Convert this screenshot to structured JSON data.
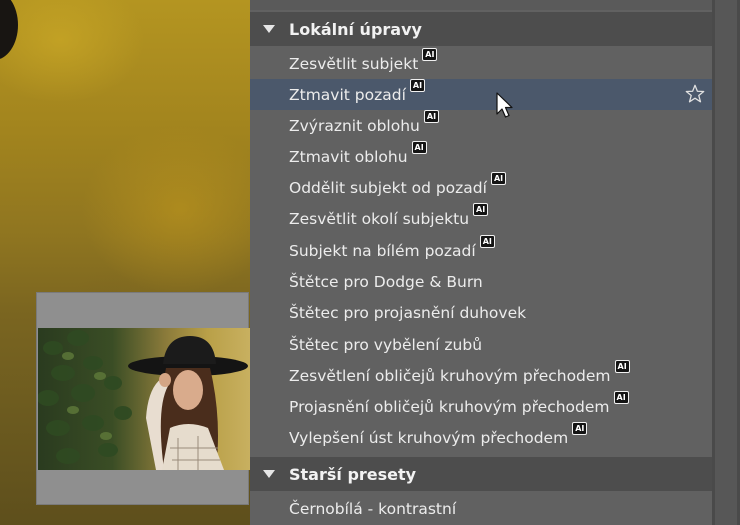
{
  "colors": {
    "panel_bg": "#616161",
    "header_bg": "#4d4d4d",
    "selected_bg": "#4b586b",
    "text": "#ececec"
  },
  "sections": [
    {
      "title": "Lokální úpravy",
      "expanded": true,
      "items": [
        {
          "label": "Zesvětlit subjekt",
          "ai": true,
          "badge": "AI"
        },
        {
          "label": "Ztmavit pozadí",
          "ai": true,
          "badge": "AI",
          "selected": true,
          "star_icon": "star-outline-icon"
        },
        {
          "label": "Zvýraznit oblohu",
          "ai": true,
          "badge": "AI"
        },
        {
          "label": "Ztmavit oblohu",
          "ai": true,
          "badge": "AI"
        },
        {
          "label": "Oddělit subjekt od pozadí",
          "ai": true,
          "badge": "AI"
        },
        {
          "label": "Zesvětlit okolí subjektu",
          "ai": true,
          "badge": "AI"
        },
        {
          "label": "Subjekt na bílém pozadí",
          "ai": true,
          "badge": "AI"
        },
        {
          "label": "Štětce pro Dodge & Burn",
          "ai": false
        },
        {
          "label": "Štětec pro projasnění duhovek",
          "ai": false
        },
        {
          "label": "Štětec pro vybělení zubů",
          "ai": false
        },
        {
          "label": "Zesvětlení obličejů kruhovým přechodem",
          "ai": true,
          "badge": "AI"
        },
        {
          "label": "Projasnění obličejů kruhovým přechodem",
          "ai": true,
          "badge": "AI"
        },
        {
          "label": "Vylepšení úst kruhovým přechodem",
          "ai": true,
          "badge": "AI"
        }
      ]
    },
    {
      "title": "Starší presety",
      "expanded": true,
      "items": [
        {
          "label": "Černobílá - kontrastní",
          "ai": false
        }
      ]
    }
  ]
}
